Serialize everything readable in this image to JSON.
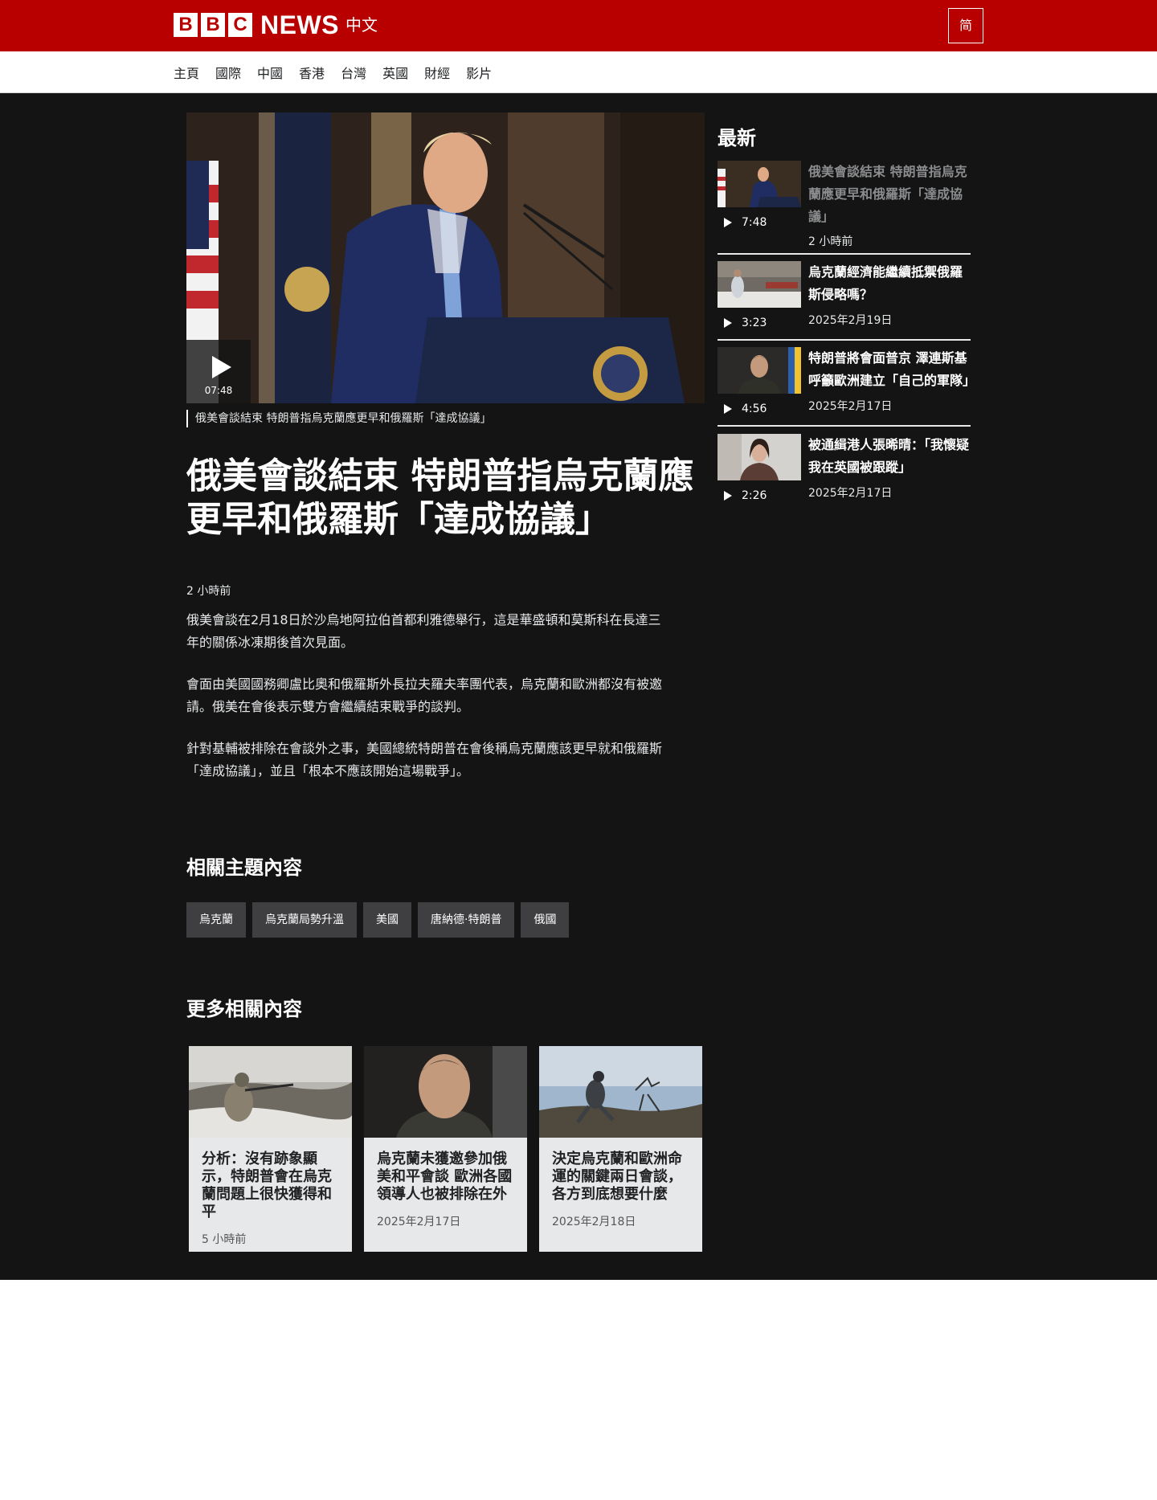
{
  "header": {
    "logo_letters": [
      "B",
      "B",
      "C"
    ],
    "logo_news": "NEWS",
    "logo_lang": "中文",
    "lang_toggle": "简",
    "brand_color": "#b80000"
  },
  "nav": [
    "主頁",
    "國際",
    "中國",
    "香港",
    "台灣",
    "英國",
    "財經",
    "影片"
  ],
  "video": {
    "duration": "07:48",
    "caption": "俄美會談結束 特朗普指烏克蘭應更早和俄羅斯「達成協議」"
  },
  "article": {
    "headline": "俄美會談結束 特朗普指烏克蘭應更早和俄羅斯「達成協議」",
    "timestamp": "2 小時前",
    "paragraphs": [
      "俄美會談在2月18日於沙烏地阿拉伯首都利雅德舉行，這是華盛頓和莫斯科在長達三年的關係冰凍期後首次見面。",
      "會面由美國國務卿盧比奧和俄羅斯外長拉夫羅夫率團代表，烏克蘭和歐洲都沒有被邀請。俄美在會後表示雙方會繼續結束戰爭的談判。",
      "針對基輔被排除在會談外之事，美國總統特朗普在會後稱烏克蘭應該更早就和俄羅斯「達成協議」，並且「根本不應該開始這場戰爭」。"
    ]
  },
  "topics": {
    "title": "相關主題內容",
    "tags": [
      "烏克蘭",
      "烏克蘭局勢升溫",
      "美國",
      "唐納德·特朗普",
      "俄國"
    ]
  },
  "more": {
    "title": "更多相關內容",
    "cards": [
      {
        "title": "分析：沒有跡象顯示，特朗普會在烏克蘭問題上很快獲得和平",
        "date": "5 小時前"
      },
      {
        "title": "烏克蘭未獲邀參加俄美和平會談 歐洲各國領導人也被排除在外",
        "date": "2025年2月17日"
      },
      {
        "title": "決定烏克蘭和歐洲命運的關鍵兩日會談，各方到底想要什麼",
        "date": "2025年2月18日"
      }
    ]
  },
  "sidebar": {
    "title": "最新",
    "items": [
      {
        "title": "俄美會談結束 特朗普指烏克蘭應更早和俄羅斯「達成協議」",
        "duration": "7:48",
        "date": "2 小時前",
        "current": true
      },
      {
        "title": "烏克蘭經濟能繼續抵禦俄羅斯侵略嗎？",
        "duration": "3:23",
        "date": "2025年2月19日"
      },
      {
        "title": "特朗普將會面普京 澤連斯基呼籲歐洲建立「自己的軍隊」",
        "duration": "4:56",
        "date": "2025年2月17日"
      },
      {
        "title": "被通緝港人張晞晴：「我懷疑我在英國被跟蹤」",
        "duration": "2:26",
        "date": "2025年2月17日"
      }
    ]
  }
}
